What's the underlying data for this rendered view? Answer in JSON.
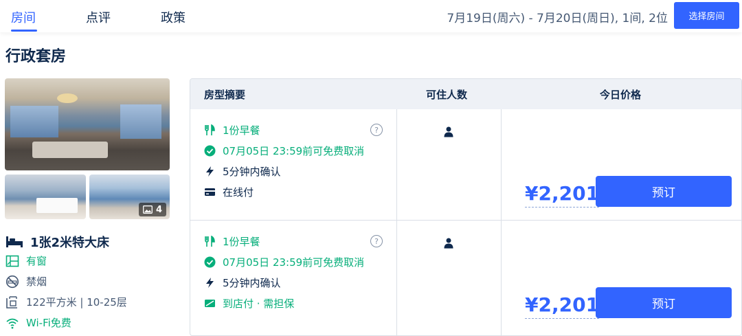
{
  "nav": {
    "tabs": [
      {
        "label": "房间",
        "active": true
      },
      {
        "label": "点评",
        "active": false
      },
      {
        "label": "政策",
        "active": false
      }
    ],
    "date_range": "7月19日(周六) - 7月20日(周日), 1间, 2位",
    "select_room_label": "选择房间"
  },
  "room": {
    "title": "行政套房",
    "photo_count": "4",
    "bed": "1张2米特大床",
    "features": [
      {
        "icon": "window-icon",
        "label": "有窗",
        "tone": "green"
      },
      {
        "icon": "no-smoking-icon",
        "label": "禁烟",
        "tone": "gray"
      },
      {
        "icon": "area-icon",
        "label": "122平方米 | 10-25层",
        "tone": "gray"
      },
      {
        "icon": "wifi-icon",
        "label": "Wi-Fi免费",
        "tone": "green"
      }
    ]
  },
  "table": {
    "headers": [
      "房型摘要",
      "可住人数",
      "今日价格"
    ],
    "rows": [
      {
        "breakfast": "1份早餐",
        "cancel": "07月05日 23:59前可免费取消",
        "confirm": "5分钟内确认",
        "payment": "在线付",
        "payment_icon": "card-icon",
        "occupancy_icon": "person-icon",
        "price": "¥2,201",
        "book_label": "预订"
      },
      {
        "breakfast": "1份早餐",
        "cancel": "07月05日 23:59前可免费取消",
        "confirm": "5分钟内确认",
        "payment": "到店付 · 需担保",
        "payment_icon": "pay-at-hotel-icon",
        "occupancy_icon": "person-icon",
        "price": "¥2,201",
        "book_label": "预订"
      }
    ]
  },
  "colors": {
    "accent": "#3264ff",
    "green": "#06ae7a",
    "text": "#0f294d",
    "header_bg": "#eef1f6"
  }
}
